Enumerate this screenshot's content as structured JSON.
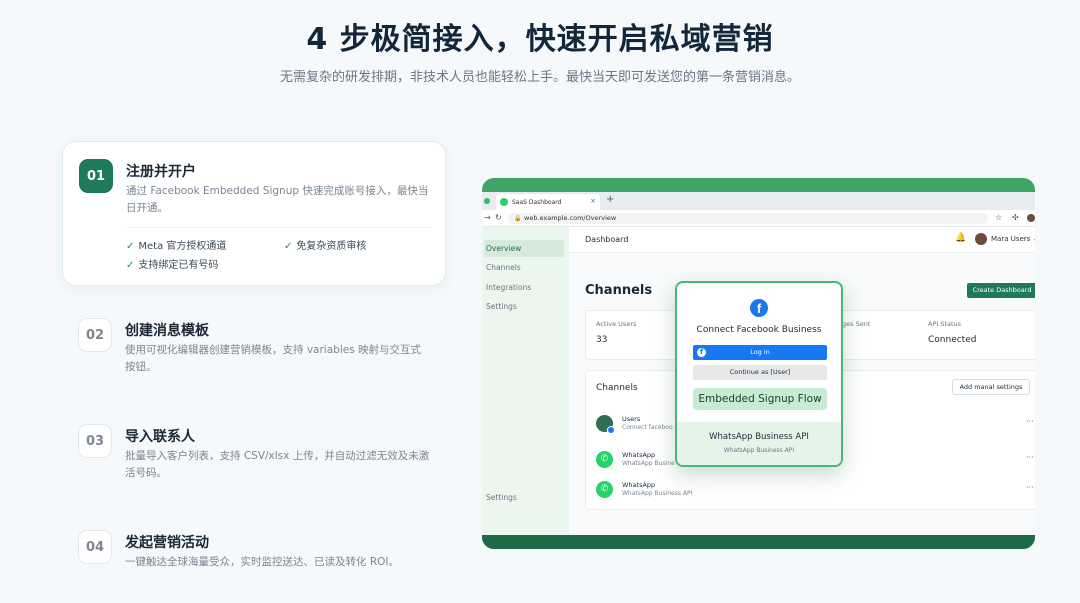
{
  "hero": {
    "title": "4 步极简接入，快速开启私域营销",
    "subtitle": "无需复杂的研发排期，非技术人员也能轻松上手。最快当天即可发送您的第一条营销消息。"
  },
  "steps": [
    {
      "number": "01",
      "title": "注册并开户",
      "desc": "通过 Facebook Embedded Signup 快速完成账号接入，最快当日开通。",
      "features": [
        "Meta 官方授权通道",
        "免复杂资质审核",
        "支持绑定已有号码"
      ]
    },
    {
      "number": "02",
      "title": "创建消息模板",
      "desc": "使用可视化编辑器创建营销模板，支持 variables 映射与交互式按钮。"
    },
    {
      "number": "03",
      "title": "导入联系人",
      "desc": "批量导入客户列表，支持 CSV/xlsx 上传，并自动过滤无效及未激活号码。"
    },
    {
      "number": "04",
      "title": "发起营销活动",
      "desc": "一键触达全球海量受众，实时监控送达、已读及转化 ROI。"
    }
  ],
  "browser": {
    "tab_title": "SaaS Dashboard",
    "tab_close": "×",
    "tab_new": "+",
    "url": "web.example.com/Overview"
  },
  "app": {
    "sidebar": [
      "Overview",
      "Channels",
      "Integrations",
      "Settings"
    ],
    "sidebar_bottom": "Settings",
    "header_title": "Dashboard",
    "user_name": "Mara Users",
    "page_title": "Channels",
    "create_button": "Create Dashboard",
    "stats": [
      {
        "label": "Active Users",
        "value": "33"
      },
      {
        "label": "ges Sent",
        "value": ""
      },
      {
        "label": "API Status",
        "value": "Connected"
      }
    ],
    "channels_title": "Channels",
    "manual_button": "Add manal settings",
    "channels": [
      {
        "name": "Users",
        "sub": "Connect faceboo"
      },
      {
        "name": "WhatsApp",
        "sub": "WhatsApp Busine"
      },
      {
        "name": "WhatsApp",
        "sub": "WhatsApp Business API"
      }
    ],
    "more": "···"
  },
  "modal": {
    "title": "Connect Facebook Business",
    "login": "Log in",
    "continue": "Continue as [User]",
    "flow": "Embedded Signup Flow",
    "footer_title": "WhatsApp Business API",
    "footer_sub": "WhatsApp Business API"
  }
}
